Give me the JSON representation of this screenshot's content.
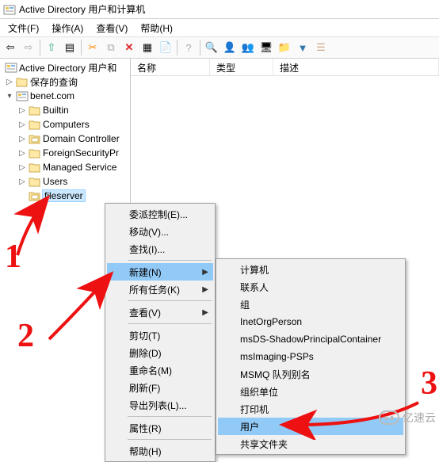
{
  "window": {
    "title": "Active Directory 用户和计算机"
  },
  "menubar": {
    "file": "文件(F)",
    "action": "操作(A)",
    "view": "查看(V)",
    "help": "帮助(H)"
  },
  "tree": {
    "root": "Active Directory 用户和",
    "saved_queries": "保存的查询",
    "domain": "benet.com",
    "builtin": "Builtin",
    "computers": "Computers",
    "dc": "Domain Controller",
    "fsp": "ForeignSecurityPr",
    "msa": "Managed Service",
    "users": "Users",
    "fileserver": "fileserver"
  },
  "list": {
    "col_name": "名称",
    "col_type": "类型",
    "col_desc": "描述"
  },
  "ctx1": {
    "delegate": "委派控制(E)...",
    "move": "移动(V)...",
    "find": "查找(I)...",
    "new": "新建(N)",
    "all_tasks": "所有任务(K)",
    "view": "查看(V)",
    "cut": "剪切(T)",
    "delete": "删除(D)",
    "rename": "重命名(M)",
    "refresh": "刷新(F)",
    "export": "导出列表(L)...",
    "properties": "属性(R)",
    "help": "帮助(H)"
  },
  "ctx2": {
    "computer": "计算机",
    "contact": "联系人",
    "group": "组",
    "inetorg": "InetOrgPerson",
    "msds": "msDS-ShadowPrincipalContainer",
    "msimaging": "msImaging-PSPs",
    "msmq": "MSMQ 队列别名",
    "ou": "组织单位",
    "printer": "打印机",
    "user": "用户",
    "shared": "共享文件夹"
  },
  "watermark": {
    "text": "亿速云"
  },
  "annotations": {
    "num1": "1",
    "num2": "2",
    "num3": "3"
  }
}
